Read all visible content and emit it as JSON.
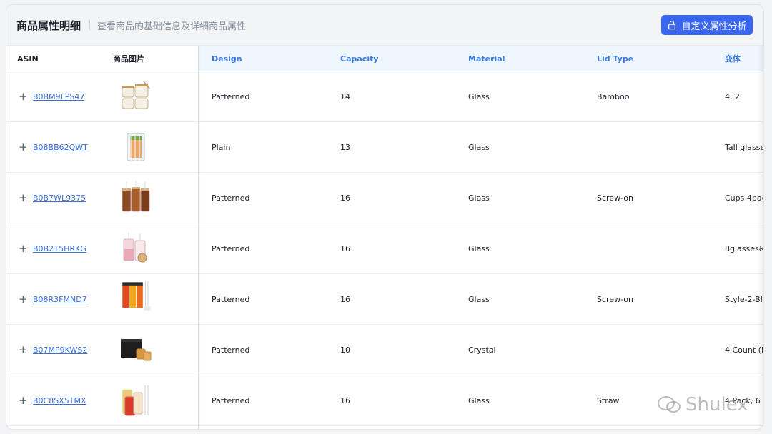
{
  "header": {
    "title": "商品属性明细",
    "subtitle": "查看商品的基础信息及详细商品属性",
    "action_label": "自定义属性分析"
  },
  "columns": {
    "asin": "ASIN",
    "image": "商品图片",
    "design": "Design",
    "capacity": "Capacity",
    "material": "Material",
    "lid_type": "Lid Type",
    "variant": "变体"
  },
  "rows": [
    {
      "asin": "B0BM9LPS47",
      "design": "Patterned",
      "capacity": "14",
      "material": "Glass",
      "lid_type": "Bamboo",
      "variant": "4, 2"
    },
    {
      "asin": "B08BB62QWT",
      "design": "Plain",
      "capacity": "13",
      "material": "Glass",
      "lid_type": "",
      "variant": "Tall glasse"
    },
    {
      "asin": "B0B7WL9375",
      "design": "Patterned",
      "capacity": "16",
      "material": "Glass",
      "lid_type": "Screw-on",
      "variant": "Cups 4pac"
    },
    {
      "asin": "B0B215HRKG",
      "design": "Patterned",
      "capacity": "16",
      "material": "Glass",
      "lid_type": "",
      "variant": "8glasses&"
    },
    {
      "asin": "B08R3FMND7",
      "design": "Patterned",
      "capacity": "16",
      "material": "Glass",
      "lid_type": "Screw-on",
      "variant": "Style-2-Bla"
    },
    {
      "asin": "B07MP9KWS2",
      "design": "Patterned",
      "capacity": "10",
      "material": "Crystal",
      "lid_type": "",
      "variant": "4 Count (F"
    },
    {
      "asin": "B0C8SX5TMX",
      "design": "Patterned",
      "capacity": "16",
      "material": "Glass",
      "lid_type": "Straw",
      "variant": "4 Pack, 6 I"
    }
  ],
  "watermark": "Shulex",
  "colors": {
    "accent": "#3a66ef",
    "link": "#3a6fd8",
    "header_blue_text": "#3a7bdc",
    "header_blue_bg": "#f0f6fd"
  }
}
